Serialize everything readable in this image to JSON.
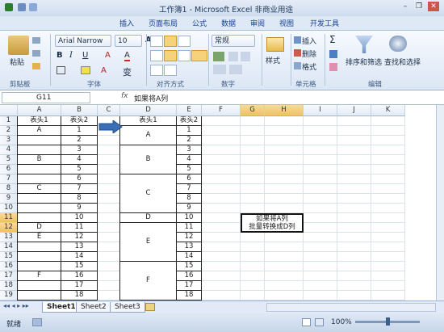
{
  "window": {
    "title": "工作簿1 - Microsoft Excel 非商业用途"
  },
  "tabs": [
    "插入",
    "页面布局",
    "公式",
    "数据",
    "审阅",
    "视图",
    "开发工具"
  ],
  "ribbon": {
    "clipboard": {
      "paste": "粘贴",
      "label": "剪贴板"
    },
    "font": {
      "name": "Arial Narrow",
      "size": "10",
      "bold": "B",
      "italic": "I",
      "underline": "U",
      "grow": "A",
      "shrink": "A",
      "label": "字体",
      "phonetic": "变"
    },
    "alignment": {
      "label": "对齐方式"
    },
    "number": {
      "format": "常规",
      "label": "数字"
    },
    "styles": {
      "label": "样式"
    },
    "cells": {
      "insert": "插入",
      "delete": "删除",
      "format": "格式",
      "label": "单元格"
    },
    "editing": {
      "sigma": "Σ",
      "sort": "排序和筛选",
      "find": "查找和选择",
      "label": "编辑"
    }
  },
  "formula_bar": {
    "name_box": "G11",
    "fx": "fx",
    "content": "如果将A列"
  },
  "columns": [
    "A",
    "B",
    "C",
    "D",
    "E",
    "F",
    "G",
    "H",
    "I",
    "J",
    "K"
  ],
  "rows": [
    "1",
    "2",
    "3",
    "4",
    "5",
    "6",
    "7",
    "8",
    "9",
    "10",
    "11",
    "12",
    "13",
    "14",
    "15",
    "16",
    "17",
    "18",
    "19"
  ],
  "headers": {
    "a1": "表头1",
    "b1": "表头2",
    "d1": "表头1",
    "e1": "表头2"
  },
  "col_a": {
    "a2": "A",
    "a5": "B",
    "a8": "C",
    "a12": "D",
    "a13": "E",
    "a17": "F"
  },
  "col_b": [
    "1",
    "2",
    "3",
    "4",
    "5",
    "6",
    "7",
    "8",
    "9",
    "10",
    "11",
    "12",
    "13",
    "14",
    "15",
    "16",
    "17",
    "18"
  ],
  "merged_d": [
    {
      "label": "A"
    },
    {
      "label": "B"
    },
    {
      "label": "C"
    },
    {
      "label": "D"
    },
    {
      "label": "E"
    },
    {
      "label": "F"
    }
  ],
  "col_e": [
    "1",
    "2",
    "3",
    "4",
    "5",
    "6",
    "7",
    "8",
    "9",
    "10",
    "11",
    "12",
    "13",
    "14",
    "15",
    "16",
    "17",
    "18"
  ],
  "note": {
    "line1": "如果将A列",
    "line2": "批量转换成D列"
  },
  "sheets": [
    "Sheet1",
    "Sheet2",
    "Sheet3"
  ],
  "status": {
    "ready": "就绪",
    "zoom": "100%"
  }
}
